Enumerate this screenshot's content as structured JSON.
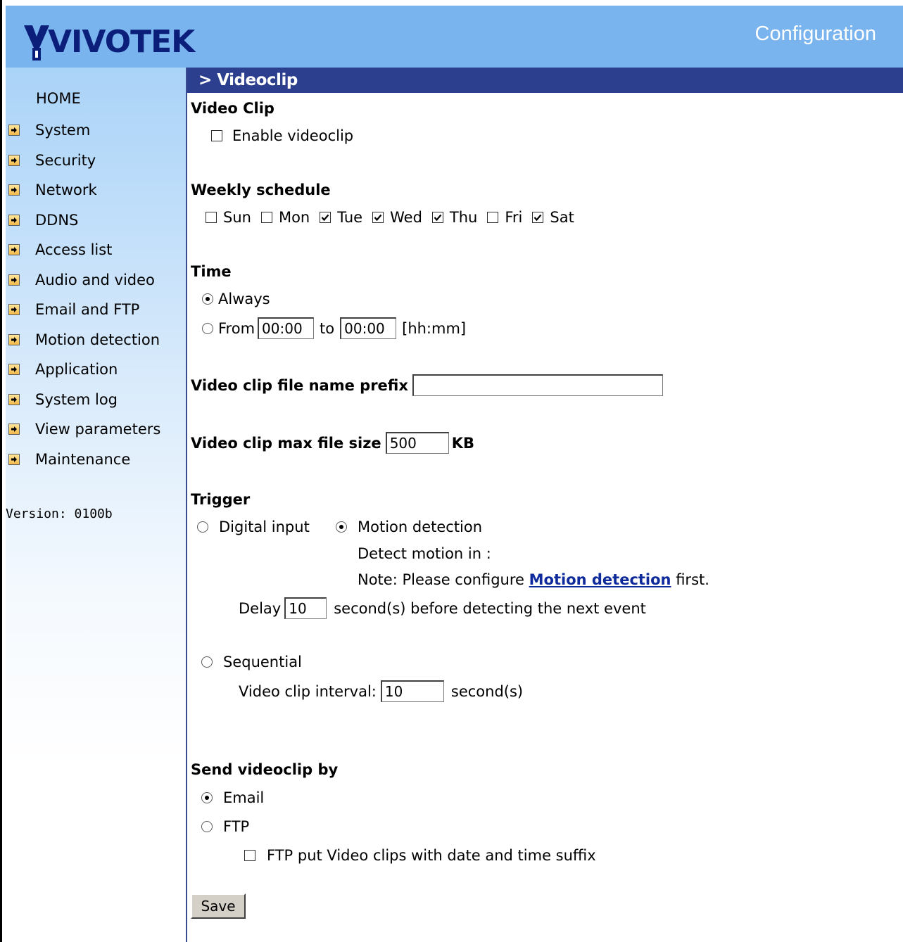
{
  "header": {
    "brand": "VIVOTEK",
    "title": "Configuration"
  },
  "sidebar": {
    "home": "HOME",
    "items": [
      {
        "label": "System"
      },
      {
        "label": "Security"
      },
      {
        "label": "Network"
      },
      {
        "label": "DDNS"
      },
      {
        "label": "Access list"
      },
      {
        "label": "Audio and video"
      },
      {
        "label": "Email and FTP"
      },
      {
        "label": "Motion detection"
      },
      {
        "label": "Application"
      },
      {
        "label": "System log"
      },
      {
        "label": "View parameters"
      },
      {
        "label": "Maintenance"
      }
    ],
    "version": "Version: 0100b"
  },
  "page": {
    "title": "> Videoclip"
  },
  "video_clip": {
    "heading": "Video Clip",
    "enable_label": "Enable videoclip",
    "enabled": false
  },
  "weekly": {
    "heading": "Weekly schedule",
    "days": [
      {
        "label": "Sun",
        "checked": false
      },
      {
        "label": "Mon",
        "checked": false
      },
      {
        "label": "Tue",
        "checked": true
      },
      {
        "label": "Wed",
        "checked": true
      },
      {
        "label": "Thu",
        "checked": true
      },
      {
        "label": "Fri",
        "checked": false
      },
      {
        "label": "Sat",
        "checked": true
      }
    ]
  },
  "time": {
    "heading": "Time",
    "always_label": "Always",
    "always_selected": true,
    "from_label": "From",
    "from_value": "00:00",
    "to_label": "to",
    "to_value": "00:00",
    "format_hint": "[hh:mm]"
  },
  "prefix": {
    "label": "Video clip file name prefix",
    "value": ""
  },
  "max_size": {
    "label": "Video clip max file size",
    "value": "500",
    "unit": "KB"
  },
  "trigger": {
    "heading": "Trigger",
    "digital_input_label": "Digital input",
    "motion_label": "Motion detection",
    "motion_selected": true,
    "detect_text": "Detect motion in :",
    "note_prefix": "Note: Please configure",
    "note_link": "Motion detection",
    "note_suffix": "first.",
    "delay_label": "Delay",
    "delay_value": "10",
    "delay_suffix": "second(s) before detecting the next event",
    "sequential_label": "Sequential",
    "interval_label": "Video clip interval:",
    "interval_value": "10",
    "interval_suffix": "second(s)"
  },
  "send": {
    "heading": "Send videoclip by",
    "email_label": "Email",
    "email_selected": true,
    "ftp_label": "FTP",
    "ftp_suffix_label": "FTP put Video clips with date and time suffix",
    "ftp_suffix_checked": false
  },
  "actions": {
    "save_label": "Save"
  },
  "colors": {
    "header_bg": "#79b4ef",
    "title_bar_bg": "#2b3f8e",
    "link": "#0f2a9a",
    "sidebar_top": "#aad3f8"
  }
}
